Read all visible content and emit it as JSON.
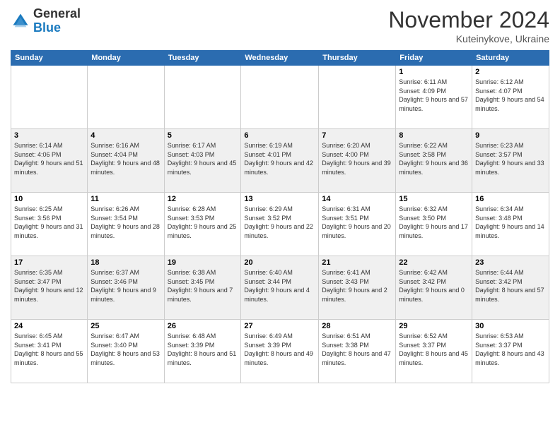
{
  "header": {
    "logo": {
      "general": "General",
      "blue": "Blue"
    },
    "title": "November 2024",
    "location": "Kuteinykove, Ukraine"
  },
  "weekdays": [
    "Sunday",
    "Monday",
    "Tuesday",
    "Wednesday",
    "Thursday",
    "Friday",
    "Saturday"
  ],
  "weeks": [
    [
      {
        "day": "",
        "info": ""
      },
      {
        "day": "",
        "info": ""
      },
      {
        "day": "",
        "info": ""
      },
      {
        "day": "",
        "info": ""
      },
      {
        "day": "",
        "info": ""
      },
      {
        "day": "1",
        "info": "Sunrise: 6:11 AM\nSunset: 4:09 PM\nDaylight: 9 hours and 57 minutes."
      },
      {
        "day": "2",
        "info": "Sunrise: 6:12 AM\nSunset: 4:07 PM\nDaylight: 9 hours and 54 minutes."
      }
    ],
    [
      {
        "day": "3",
        "info": "Sunrise: 6:14 AM\nSunset: 4:06 PM\nDaylight: 9 hours and 51 minutes."
      },
      {
        "day": "4",
        "info": "Sunrise: 6:16 AM\nSunset: 4:04 PM\nDaylight: 9 hours and 48 minutes."
      },
      {
        "day": "5",
        "info": "Sunrise: 6:17 AM\nSunset: 4:03 PM\nDaylight: 9 hours and 45 minutes."
      },
      {
        "day": "6",
        "info": "Sunrise: 6:19 AM\nSunset: 4:01 PM\nDaylight: 9 hours and 42 minutes."
      },
      {
        "day": "7",
        "info": "Sunrise: 6:20 AM\nSunset: 4:00 PM\nDaylight: 9 hours and 39 minutes."
      },
      {
        "day": "8",
        "info": "Sunrise: 6:22 AM\nSunset: 3:58 PM\nDaylight: 9 hours and 36 minutes."
      },
      {
        "day": "9",
        "info": "Sunrise: 6:23 AM\nSunset: 3:57 PM\nDaylight: 9 hours and 33 minutes."
      }
    ],
    [
      {
        "day": "10",
        "info": "Sunrise: 6:25 AM\nSunset: 3:56 PM\nDaylight: 9 hours and 31 minutes."
      },
      {
        "day": "11",
        "info": "Sunrise: 6:26 AM\nSunset: 3:54 PM\nDaylight: 9 hours and 28 minutes."
      },
      {
        "day": "12",
        "info": "Sunrise: 6:28 AM\nSunset: 3:53 PM\nDaylight: 9 hours and 25 minutes."
      },
      {
        "day": "13",
        "info": "Sunrise: 6:29 AM\nSunset: 3:52 PM\nDaylight: 9 hours and 22 minutes."
      },
      {
        "day": "14",
        "info": "Sunrise: 6:31 AM\nSunset: 3:51 PM\nDaylight: 9 hours and 20 minutes."
      },
      {
        "day": "15",
        "info": "Sunrise: 6:32 AM\nSunset: 3:50 PM\nDaylight: 9 hours and 17 minutes."
      },
      {
        "day": "16",
        "info": "Sunrise: 6:34 AM\nSunset: 3:48 PM\nDaylight: 9 hours and 14 minutes."
      }
    ],
    [
      {
        "day": "17",
        "info": "Sunrise: 6:35 AM\nSunset: 3:47 PM\nDaylight: 9 hours and 12 minutes."
      },
      {
        "day": "18",
        "info": "Sunrise: 6:37 AM\nSunset: 3:46 PM\nDaylight: 9 hours and 9 minutes."
      },
      {
        "day": "19",
        "info": "Sunrise: 6:38 AM\nSunset: 3:45 PM\nDaylight: 9 hours and 7 minutes."
      },
      {
        "day": "20",
        "info": "Sunrise: 6:40 AM\nSunset: 3:44 PM\nDaylight: 9 hours and 4 minutes."
      },
      {
        "day": "21",
        "info": "Sunrise: 6:41 AM\nSunset: 3:43 PM\nDaylight: 9 hours and 2 minutes."
      },
      {
        "day": "22",
        "info": "Sunrise: 6:42 AM\nSunset: 3:42 PM\nDaylight: 9 hours and 0 minutes."
      },
      {
        "day": "23",
        "info": "Sunrise: 6:44 AM\nSunset: 3:42 PM\nDaylight: 8 hours and 57 minutes."
      }
    ],
    [
      {
        "day": "24",
        "info": "Sunrise: 6:45 AM\nSunset: 3:41 PM\nDaylight: 8 hours and 55 minutes."
      },
      {
        "day": "25",
        "info": "Sunrise: 6:47 AM\nSunset: 3:40 PM\nDaylight: 8 hours and 53 minutes."
      },
      {
        "day": "26",
        "info": "Sunrise: 6:48 AM\nSunset: 3:39 PM\nDaylight: 8 hours and 51 minutes."
      },
      {
        "day": "27",
        "info": "Sunrise: 6:49 AM\nSunset: 3:39 PM\nDaylight: 8 hours and 49 minutes."
      },
      {
        "day": "28",
        "info": "Sunrise: 6:51 AM\nSunset: 3:38 PM\nDaylight: 8 hours and 47 minutes."
      },
      {
        "day": "29",
        "info": "Sunrise: 6:52 AM\nSunset: 3:37 PM\nDaylight: 8 hours and 45 minutes."
      },
      {
        "day": "30",
        "info": "Sunrise: 6:53 AM\nSunset: 3:37 PM\nDaylight: 8 hours and 43 minutes."
      }
    ]
  ]
}
